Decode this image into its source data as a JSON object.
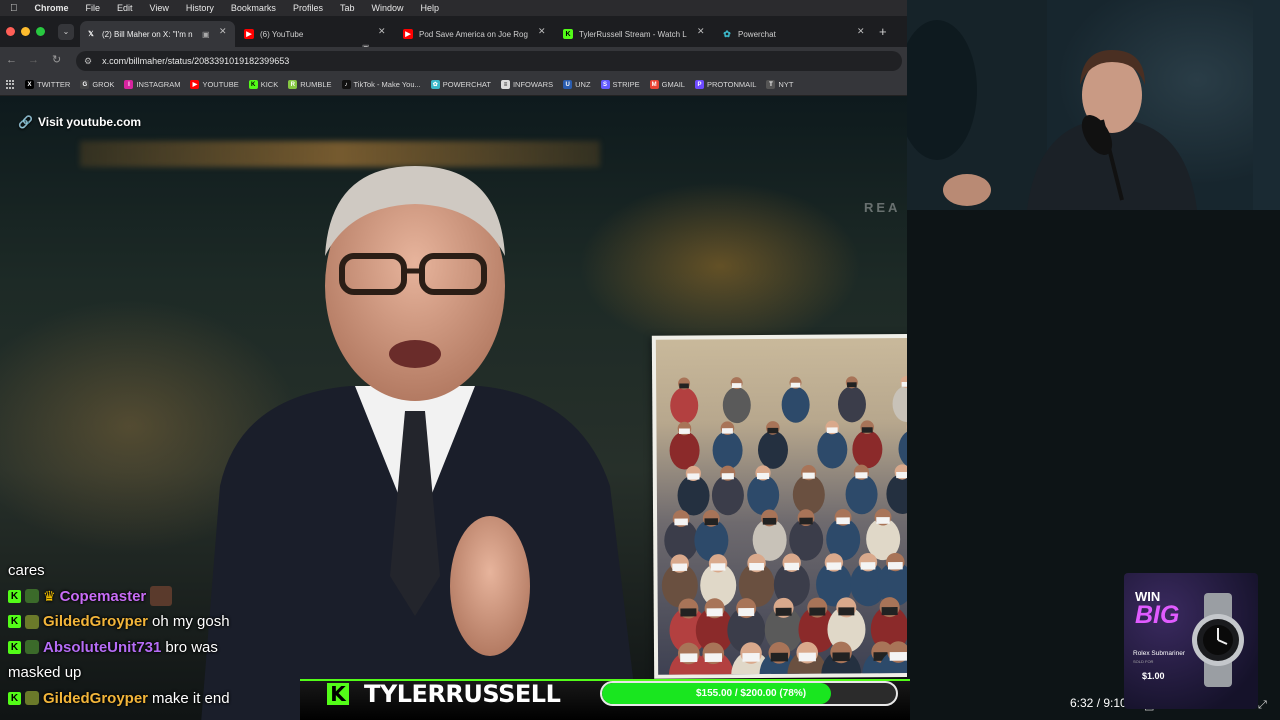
{
  "menubar": {
    "app_name": "Chrome",
    "items": [
      "File",
      "Edit",
      "View",
      "History",
      "Bookmarks",
      "Profiles",
      "Tab",
      "Window",
      "Help"
    ]
  },
  "tabs": [
    {
      "title": "(2) Bill Maher on X: \"I'm n",
      "icon": "x-icon",
      "active": true
    },
    {
      "title": "(6) YouTube",
      "icon": "youtube-icon",
      "active": false
    },
    {
      "title": "Pod Save America on Joe Rog",
      "icon": "youtube-icon",
      "active": false
    },
    {
      "title": "TylerRussell Stream - Watch L",
      "icon": "kick-icon",
      "active": false
    },
    {
      "title": "Powerchat",
      "icon": "powerchat-icon",
      "active": false
    }
  ],
  "omnibox": {
    "url": "x.com/billmaher/status/2083391019182399653"
  },
  "bookmarks": [
    {
      "label": "TWITTER",
      "icon": "x-icon",
      "color": "#000000"
    },
    {
      "label": "GROK",
      "icon": "grok-icon",
      "color": "#444444"
    },
    {
      "label": "INSTAGRAM",
      "icon": "instagram-icon",
      "color": "#d6249f"
    },
    {
      "label": "YOUTUBE",
      "icon": "youtube-icon",
      "color": "#ff0000"
    },
    {
      "label": "KICK",
      "icon": "kick-icon",
      "color": "#53fc18"
    },
    {
      "label": "RUMBLE",
      "icon": "rumble-icon",
      "color": "#85c742"
    },
    {
      "label": "TikTok - Make You...",
      "icon": "tiktok-icon",
      "color": "#111111"
    },
    {
      "label": "POWERCHAT",
      "icon": "powerchat-icon",
      "color": "#3cb8c9"
    },
    {
      "label": "INFOWARS",
      "icon": "infowars-icon",
      "color": "#dddddd"
    },
    {
      "label": "UNZ",
      "icon": "unz-icon",
      "color": "#2a5db0"
    },
    {
      "label": "STRIPE",
      "icon": "stripe-icon",
      "color": "#635bff"
    },
    {
      "label": "GMAIL",
      "icon": "gmail-icon",
      "color": "#ea4335"
    },
    {
      "label": "PROTONMAIL",
      "icon": "protonmail-icon",
      "color": "#6d4aff"
    },
    {
      "label": "NYT",
      "icon": "nyt-icon",
      "color": "#555555"
    }
  ],
  "video": {
    "visit_link": "Visit youtube.com",
    "rea_text": "REA",
    "time": "6:32 / 9:10"
  },
  "chat": {
    "messages": [
      {
        "user": "",
        "text": "cares",
        "user_color": "#ffffff"
      },
      {
        "user": "Copemaster",
        "text": "",
        "user_color": "#c76cf5"
      },
      {
        "user": "GildedGroyper",
        "text": "oh my gosh",
        "user_color": "#f2b53a"
      },
      {
        "user": "AbsoluteUnit731",
        "text": "bro was",
        "user_color": "#b56cf5"
      },
      {
        "user": "",
        "text": "masked up",
        "user_color": "#ffffff"
      },
      {
        "user": "GildedGroyper",
        "text": "make it end",
        "user_color": "#f2b53a"
      }
    ]
  },
  "overlay": {
    "streamer_name": "TYLERRUSSELL",
    "kick_letter": "K",
    "goal_text": "$155.00 / $200.00 (78%)",
    "goal_fraction": 0.78,
    "accent": "#53fc18"
  },
  "ad": {
    "win": "WIN",
    "big": "BIG",
    "product": "Rolex Submariner",
    "sub": "SOLD FOR",
    "price": "$1.00"
  }
}
